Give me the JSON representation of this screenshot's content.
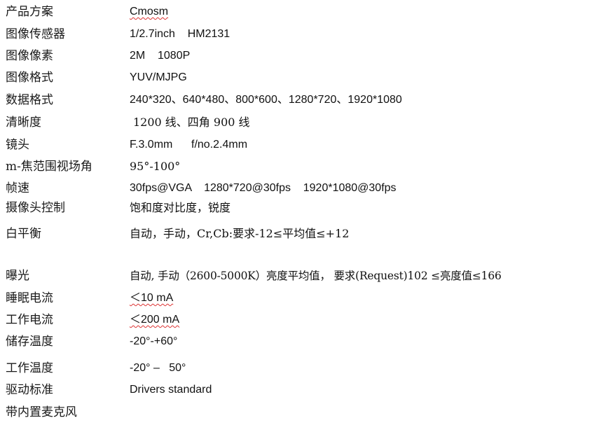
{
  "specs": [
    {
      "label": "产品方案",
      "value": "Cmosm"
    },
    {
      "label": "图像传感器",
      "value": "1/2.7inch    HM2131"
    },
    {
      "label": "图像像素",
      "value": "2M    1080P"
    },
    {
      "label": "图像格式",
      "value": "YUV/MJPG"
    },
    {
      "label": "数据格式",
      "value": "240*320、640*480、800*600、1280*720、1920*1080"
    },
    {
      "label": "清晰度",
      "value": "1200 线、四角 900 线"
    },
    {
      "label": "镜头",
      "value": "F.3.0mm      f/no.2.4mm"
    },
    {
      "label": "m-焦范围视场角",
      "value": "95°-100°"
    },
    {
      "label": "帧速",
      "value": "30fps@VGA    1280*720@30fps    1920*1080@30fps"
    },
    {
      "label": "摄像头控制",
      "value": "饱和度对比度，锐度"
    },
    {
      "label": "白平衡",
      "value": "自动，手动，Cr,Cb:要求-12≤平均值≤+12"
    },
    {
      "label": "曝光",
      "value": "自动, 手动（2600-5000K）亮度平均值，  要求(Request)102 ≤亮度值≤166"
    },
    {
      "label": "睡眠电流",
      "value": "＜10 mA"
    },
    {
      "label": "工作电流",
      "value": "＜200 mA"
    },
    {
      "label": "储存温度",
      "value": "-20°-+60°"
    },
    {
      "label": "工作温度",
      "value": "-20° –   50°"
    },
    {
      "label": "驱动标准",
      "value": "Drivers standard"
    },
    {
      "label": "带内置麦克风",
      "value": ""
    }
  ]
}
